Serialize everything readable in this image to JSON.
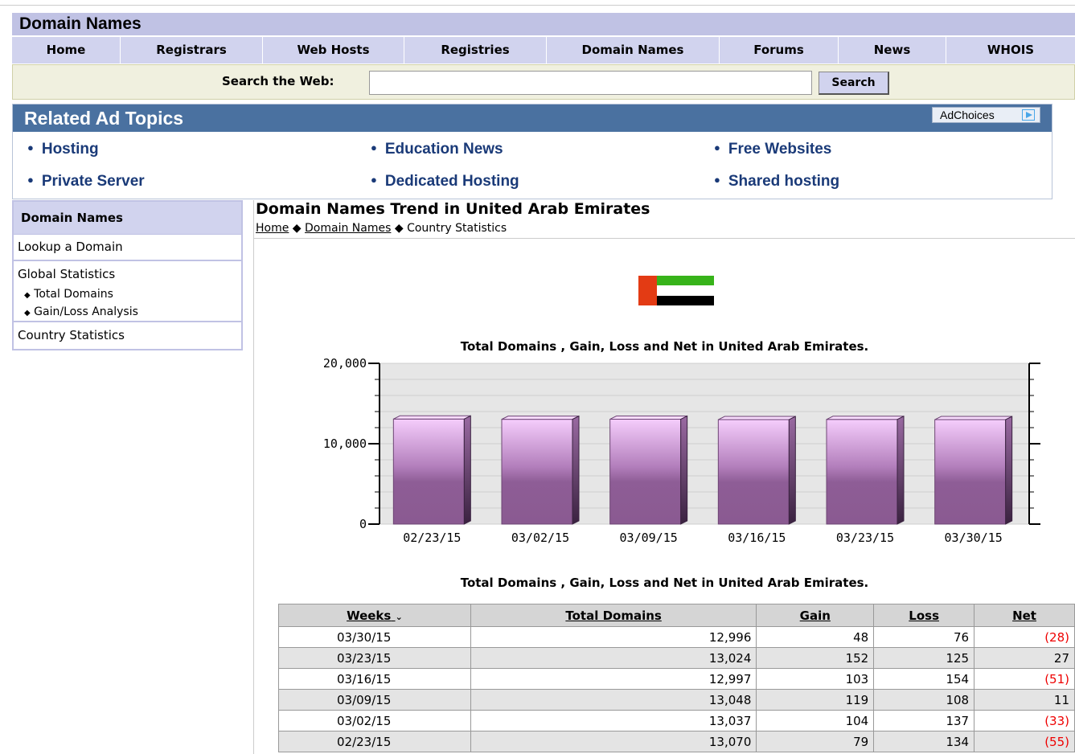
{
  "site": {
    "title": "Domain Names"
  },
  "nav": [
    "Home",
    "Registrars",
    "Web Hosts",
    "Registries",
    "Domain Names",
    "Forums",
    "News",
    "WHOIS"
  ],
  "search": {
    "label": "Search the Web:",
    "value": "",
    "button": "Search"
  },
  "ads": {
    "title": "Related Ad Topics",
    "adchoices": "AdChoices",
    "links": [
      "Hosting",
      "Education News",
      "Free Websites",
      "Private Server",
      "Dedicated Hosting",
      "Shared hosting"
    ]
  },
  "sidebar": {
    "title": "Domain Names",
    "items": [
      "Lookup a Domain",
      "Global Statistics",
      "Country Statistics"
    ],
    "subitems": [
      "Total Domains",
      "Gain/Loss Analysis"
    ]
  },
  "page": {
    "title": "Domain Names Trend in United Arab Emirates",
    "breadcrumb": {
      "home": "Home",
      "section": "Domain Names",
      "current": "Country Statistics",
      "separator": "◆"
    }
  },
  "chart_data": {
    "type": "bar",
    "title": "Total Domains , Gain, Loss and Net in United Arab Emirates.",
    "categories": [
      "02/23/15",
      "03/02/15",
      "03/09/15",
      "03/16/15",
      "03/23/15",
      "03/30/15"
    ],
    "values": [
      13070,
      13037,
      13048,
      12997,
      13024,
      12996
    ],
    "ylim": [
      0,
      20000
    ],
    "yticks": [
      "20,000",
      "10,000",
      "0"
    ],
    "grid": true
  },
  "table": {
    "title": "Total Domains , Gain, Loss and Net in United Arab Emirates.",
    "headers": [
      "Weeks",
      "Total Domains",
      "Gain",
      "Loss",
      "Net"
    ],
    "rows": [
      [
        "03/30/15",
        "12,996",
        "48",
        "76",
        "(28)"
      ],
      [
        "03/23/15",
        "13,024",
        "152",
        "125",
        "27"
      ],
      [
        "03/16/15",
        "12,997",
        "103",
        "154",
        "(51)"
      ],
      [
        "03/09/15",
        "13,048",
        "119",
        "108",
        "11"
      ],
      [
        "03/02/15",
        "13,037",
        "104",
        "137",
        "(33)"
      ],
      [
        "02/23/15",
        "13,070",
        "79",
        "134",
        "(55)"
      ]
    ]
  },
  "colors": {
    "bar_light": "#f3c8fb",
    "bar_dark": "#8a5a91",
    "negative": "#e00000",
    "nav": "#d1d3ee",
    "ad_header": "#4a71a0"
  }
}
